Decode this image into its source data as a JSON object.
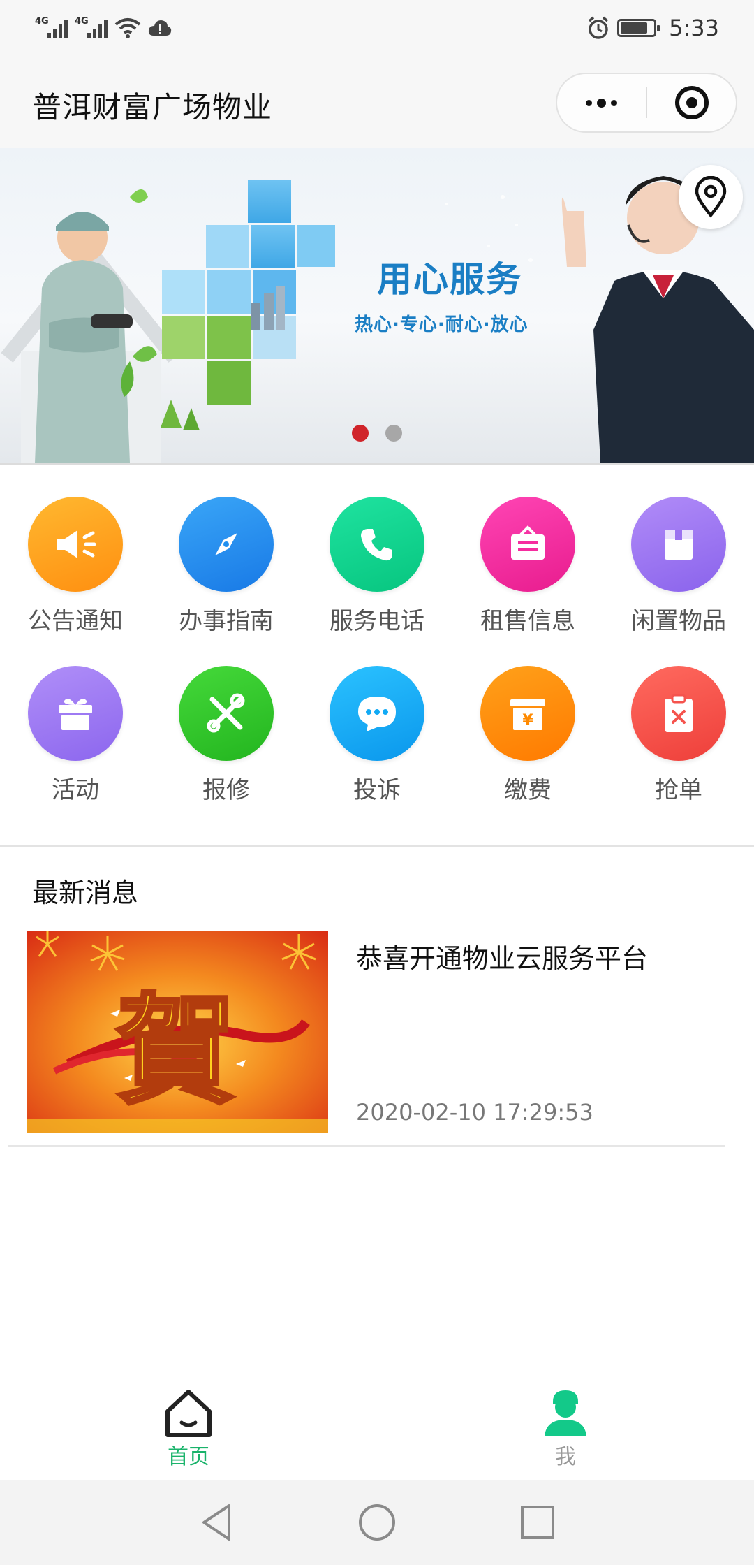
{
  "status_bar": {
    "network_1": "4G",
    "network_2": "4G",
    "time": "5:33",
    "icons": [
      "signal-icon",
      "signal-icon",
      "wifi-icon",
      "cloud-icon",
      "alarm-icon",
      "battery-icon"
    ]
  },
  "header": {
    "title": "普洱财富广场物业",
    "icons": [
      "more-icon",
      "close-target-icon"
    ]
  },
  "banner": {
    "headline": "用心服务",
    "subline": "热心·专心·耐心·放心",
    "slide_count": 2,
    "active_slide": 1,
    "icons": [
      "location-pin-icon"
    ]
  },
  "grid": {
    "items": [
      {
        "label": "公告通知",
        "icon": "megaphone-icon",
        "color": "#ff9f1c"
      },
      {
        "label": "办事指南",
        "icon": "compass-icon",
        "color": "#1e8ff0"
      },
      {
        "label": "服务电话",
        "icon": "phone-icon",
        "color": "#0fd68d"
      },
      {
        "label": "租售信息",
        "icon": "sign-icon",
        "color": "#f52d9f"
      },
      {
        "label": "闲置物品",
        "icon": "box-icon",
        "color": "#9b72f0"
      },
      {
        "label": "活动",
        "icon": "gift-icon",
        "color": "#9878f2"
      },
      {
        "label": "报修",
        "icon": "tools-icon",
        "color": "#2fc52f"
      },
      {
        "label": "投诉",
        "icon": "chat-icon",
        "color": "#11aaf5"
      },
      {
        "label": "缴费",
        "icon": "payment-icon",
        "color": "#ff8a00"
      },
      {
        "label": "抢单",
        "icon": "clipboard-icon",
        "color": "#f5534d"
      }
    ]
  },
  "news": {
    "heading": "最新消息",
    "items": [
      {
        "title": "恭喜开通物业云服务平台",
        "time": "2020-02-10 17:29:53",
        "thumb_text": "賀"
      }
    ]
  },
  "tab_bar": {
    "tabs": [
      {
        "label": "首页",
        "icon": "home-icon",
        "active": true,
        "color": "#1ab36b"
      },
      {
        "label": "我",
        "icon": "user-icon",
        "active": false,
        "color": "#999999"
      }
    ]
  },
  "system_nav": {
    "icons": [
      "back-icon",
      "home-circle-icon",
      "recents-icon"
    ]
  }
}
